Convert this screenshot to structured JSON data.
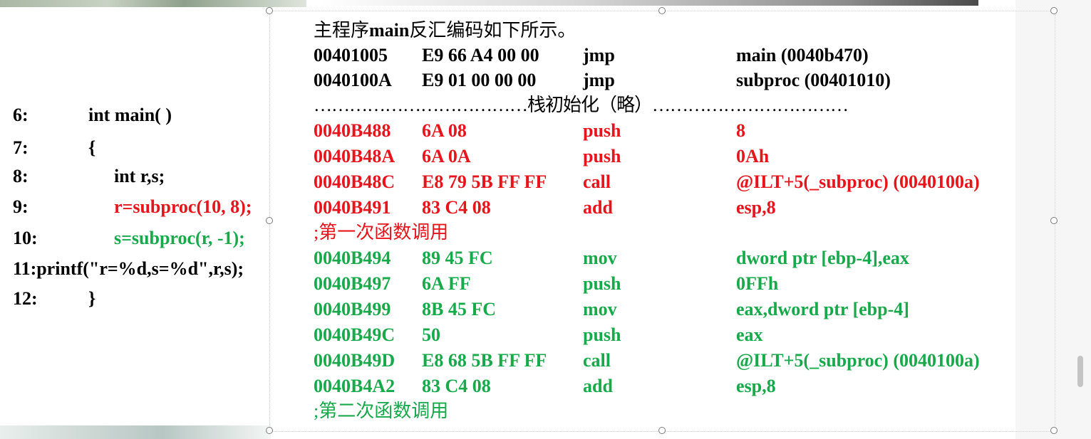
{
  "colors": {
    "red": "#e8141b",
    "green": "#17a94a",
    "black": "#000000"
  },
  "source": {
    "lines": [
      {
        "num": "6:",
        "code": "int main( )"
      },
      {
        "num": "7:",
        "code": "{"
      },
      {
        "num": "8:",
        "code": "int r,s;"
      },
      {
        "num": "9:",
        "code": "r=subproc(10, 8);"
      },
      {
        "num": "10:",
        "code": "s=subproc(r, -1);"
      },
      {
        "full": "11:printf(\"r=%d,s=%d\",r,s);"
      },
      {
        "num": "12:",
        "code": "}"
      }
    ]
  },
  "disasm": {
    "heading_prefix": "主程序",
    "heading_main": "main",
    "heading_suffix": "反汇编码如下所示。",
    "rows": [
      {
        "addr": "00401005",
        "bytes": "E9 66 A4 00 00",
        "op": "jmp",
        "arg": "main (0040b470)"
      },
      {
        "addr": "0040100A",
        "bytes": "E9 01 00 00 00",
        "op": "jmp",
        "arg": "subproc (00401010)"
      },
      {
        "separator": "………………………………栈初始化（略）……………………………"
      },
      {
        "addr": "0040B488",
        "bytes": "6A 08",
        "op": "push",
        "arg": "8"
      },
      {
        "addr": "0040B48A",
        "bytes": "6A 0A",
        "op": "push",
        "arg": "0Ah"
      },
      {
        "addr": "0040B48C",
        "bytes": "E8 79 5B FF FF",
        "op": "call",
        "arg": "@ILT+5(_subproc) (0040100a)"
      },
      {
        "addr": "0040B491",
        "bytes": "83 C4 08",
        "op": "add",
        "arg": "esp,8"
      },
      {
        "comment": ";第一次函数调用"
      },
      {
        "addr": "0040B494",
        "bytes": "89 45 FC",
        "op": "mov",
        "arg": "dword ptr [ebp-4],eax"
      },
      {
        "addr": "0040B497",
        "bytes": "6A FF",
        "op": "push",
        "arg": "0FFh"
      },
      {
        "addr": "0040B499",
        "bytes": "8B 45 FC",
        "op": "mov",
        "arg": "eax,dword ptr [ebp-4]"
      },
      {
        "addr": "0040B49C",
        "bytes": "50",
        "op": "push",
        "arg": "eax"
      },
      {
        "addr": "0040B49D",
        "bytes": "E8 68 5B FF FF",
        "op": "call",
        "arg": "@ILT+5(_subproc) (0040100a)"
      },
      {
        "addr": "0040B4A2",
        "bytes": "83 C4 08",
        "op": "add",
        "arg": "esp,8"
      },
      {
        "comment": ";第二次函数调用"
      }
    ]
  }
}
